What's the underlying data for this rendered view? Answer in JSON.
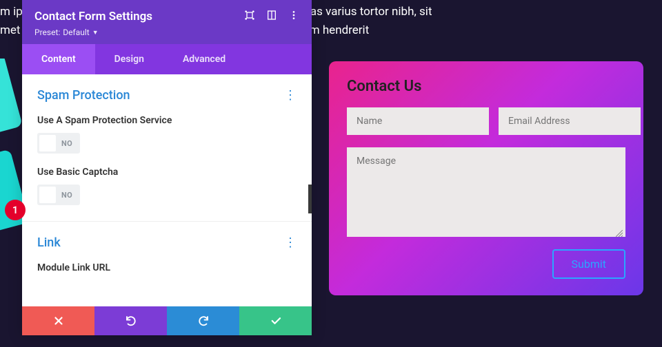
{
  "bg_text": "m ipsum dolor sit amet, consectetur adipiscing elit. Maecenas varius tortor nibh, sit met                                                                                               uam hendrerit",
  "marker": "1",
  "panel": {
    "title": "Contact Form Settings",
    "preset_label": "Preset:",
    "preset_value": "Default",
    "tabs": {
      "content": "Content",
      "design": "Design",
      "advanced": "Advanced"
    }
  },
  "sections": {
    "spam": {
      "title": "Spam Protection",
      "field1": "Use A Spam Protection Service",
      "field2": "Use Basic Captcha",
      "toggle_no": "NO"
    },
    "link": {
      "title": "Link",
      "field1": "Module Link URL"
    }
  },
  "form": {
    "title": "Contact Us",
    "name_ph": "Name",
    "email_ph": "Email Address",
    "msg_ph": "Message",
    "submit": "Submit"
  }
}
